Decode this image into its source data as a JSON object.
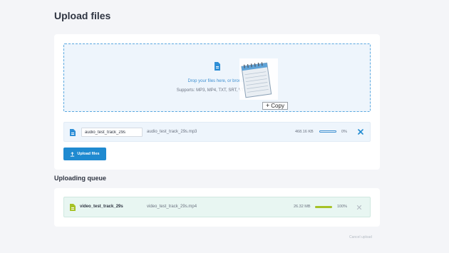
{
  "page": {
    "title": "Upload files"
  },
  "dropzone": {
    "text": "Drop your files here, or browse",
    "supports": "Supports: MP3, MP4, TXT, SRT, VTT, CSV",
    "drag_badge": "Copy",
    "icon": "document-icon",
    "drag_icon": "notepad-icon"
  },
  "pending_file": {
    "name_value": "audio_test_track_29s",
    "filename": "audio_test_track_29s.mp3",
    "size": "468.16 KB",
    "progress_label": "0%",
    "progress": 0,
    "icon": "document-icon",
    "remove_icon": "close-icon"
  },
  "upload_button": {
    "label": "Upload files",
    "icon": "upload-icon"
  },
  "queue": {
    "title": "Uploading queue",
    "items": [
      {
        "name": "video_test_track_29s",
        "filename": "video_test_track_29s.mp4",
        "size": "26.32 MB",
        "progress_label": "100%",
        "progress": 1.0,
        "icon": "document-icon",
        "remove_icon": "close-icon"
      }
    ]
  },
  "cancel_link": {
    "label": "Cancel upload"
  },
  "colors": {
    "accent": "#1f8ad0",
    "close_active": "#1f8ad0",
    "progress_complete": "#a6c226",
    "queue_bg": "#e8f6f2",
    "dropzone_bg": "#eef5fc"
  }
}
